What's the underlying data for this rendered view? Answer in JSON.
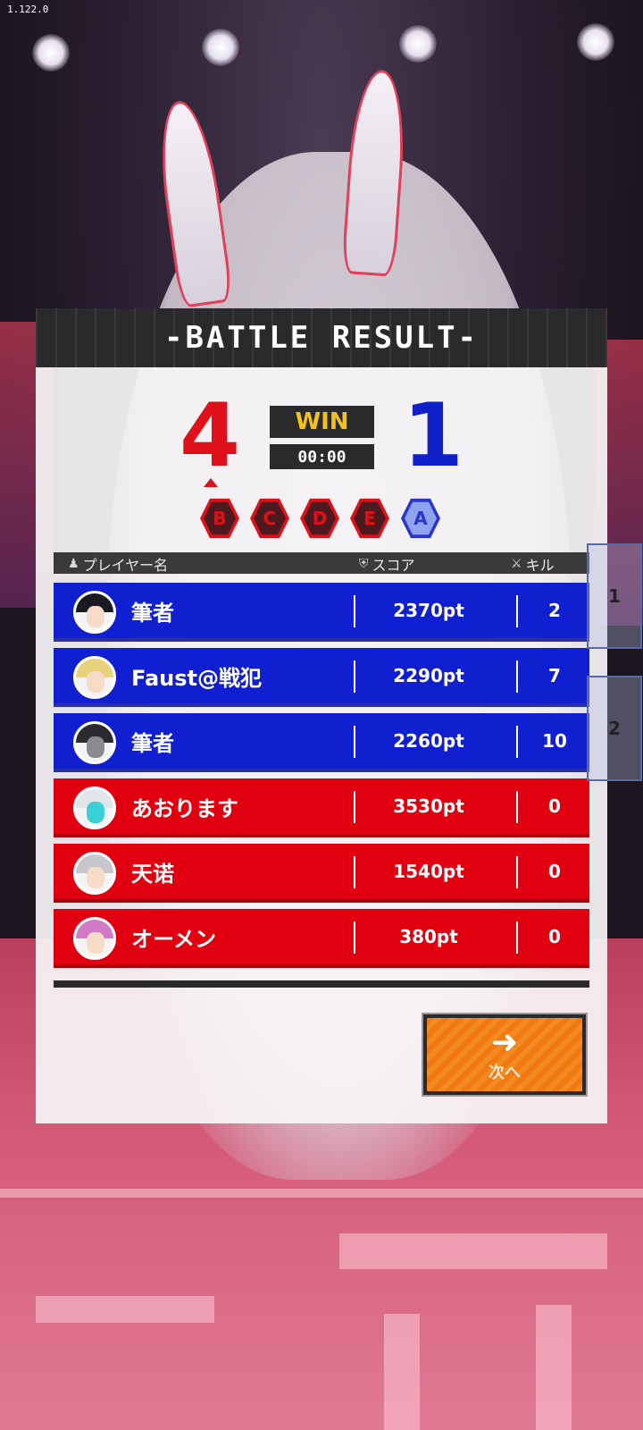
{
  "version": "1.122.0",
  "header": {
    "title": "-BATTLE RESULT-"
  },
  "match": {
    "score_left": "4",
    "score_right": "1",
    "result": "WIN",
    "timer": "00:00",
    "ranks": [
      {
        "letter": "B",
        "team": "red"
      },
      {
        "letter": "C",
        "team": "red"
      },
      {
        "letter": "D",
        "team": "red"
      },
      {
        "letter": "E",
        "team": "red"
      },
      {
        "letter": "A",
        "team": "blue"
      }
    ],
    "colors": {
      "red_team": "#e00010",
      "blue_team": "#1020d0",
      "win_text": "#f2c21a"
    }
  },
  "table": {
    "col_player": "プレイヤー名",
    "col_score": "スコア",
    "col_kills": "キル",
    "rows": [
      {
        "name": "筆者",
        "score": "2370pt",
        "kills": "2",
        "team": "blue"
      },
      {
        "name": "Faust@戦犯",
        "score": "2290pt",
        "kills": "7",
        "team": "blue"
      },
      {
        "name": "筆者",
        "score": "2260pt",
        "kills": "10",
        "team": "blue"
      },
      {
        "name": "あおります",
        "score": "3530pt",
        "kills": "0",
        "team": "red"
      },
      {
        "name": "天诺",
        "score": "1540pt",
        "kills": "0",
        "team": "red"
      },
      {
        "name": "オーメン",
        "score": "380pt",
        "kills": "0",
        "team": "red"
      }
    ]
  },
  "side_tabs": [
    "1",
    "2"
  ],
  "next_button": {
    "label": "次へ",
    "icon": "arrow-right-icon"
  }
}
